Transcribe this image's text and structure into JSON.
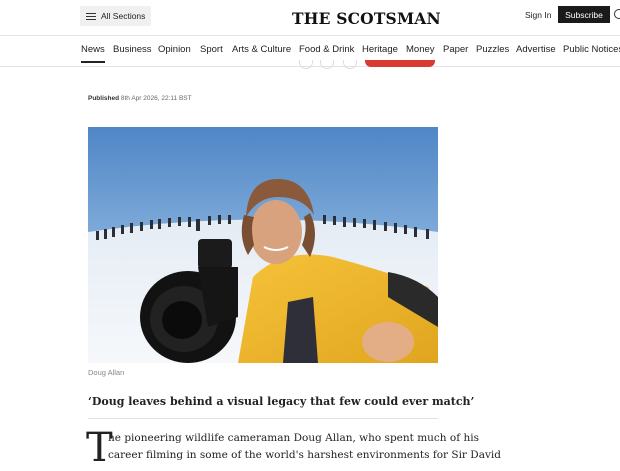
{
  "header": {
    "sections_label": "All Sections",
    "logo": "THE SCOTSMAN",
    "signin_label": "Sign In",
    "subscribe_label": "Subscribe"
  },
  "nav": {
    "items": [
      "News",
      "Business",
      "Opinion",
      "Sport",
      "Arts & Culture",
      "Food & Drink",
      "Heritage",
      "Money",
      "Paper",
      "Puzzles",
      "Advertise",
      "Public Notices"
    ],
    "active": "News"
  },
  "article": {
    "published_label": "Published",
    "published_date": "8th Apr 2026, 22:11 BST",
    "image_credit": "Doug Allan",
    "pullquote": "‘Doug leaves behind a visual legacy that few could ever match’",
    "dropcap": "T",
    "body_line_1": "he pioneering wildlife cameraman Doug Allan, who spent much of his",
    "body_line_2": "career filming in some of the world's harshest environments for Sir David"
  },
  "colors": {
    "subscribe_bg": "#1a1a1a",
    "accent_red": "#d93a34",
    "sky": "#6f9ed0",
    "jacket": "#f2b82a"
  }
}
